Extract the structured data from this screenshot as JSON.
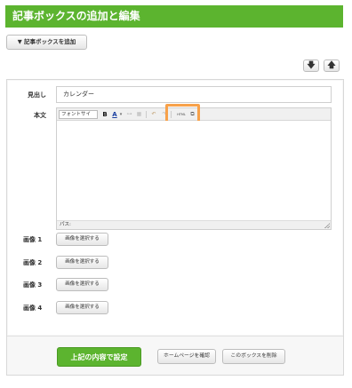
{
  "page": {
    "title": "記事ボックスの追加と編集",
    "add_box_label": "▼ 記事ボックスを追加",
    "move_down_glyph": "🡇",
    "move_up_glyph": "🡅"
  },
  "form": {
    "heading_label": "見出し",
    "heading_value": "カレンダー",
    "body_label": "本文"
  },
  "editor": {
    "font_select_value": "フォントサイ",
    "bold_glyph": "B",
    "text_color_glyph": "A",
    "caret_glyph": "▾",
    "link_glyph": "⊶",
    "image_glyph": "▦",
    "undo_glyph": "↶",
    "redo_glyph": "↷",
    "html_label": "HTML",
    "fullscreen_glyph": "⧉",
    "status_label": "パス:",
    "highlight_color": "#f7a14a"
  },
  "images": [
    {
      "label": "画像 1",
      "button": "画像を選択する"
    },
    {
      "label": "画像 2",
      "button": "画像を選択する"
    },
    {
      "label": "画像 3",
      "button": "画像を選択する"
    },
    {
      "label": "画像 4",
      "button": "画像を選択する"
    }
  ],
  "footer": {
    "submit_label": "上記の内容で設定",
    "homepage_label": "ホームページを確認",
    "delete_label": "このボックスを削除"
  },
  "colors": {
    "accent": "#5cb42f",
    "highlight": "#f7a14a"
  }
}
